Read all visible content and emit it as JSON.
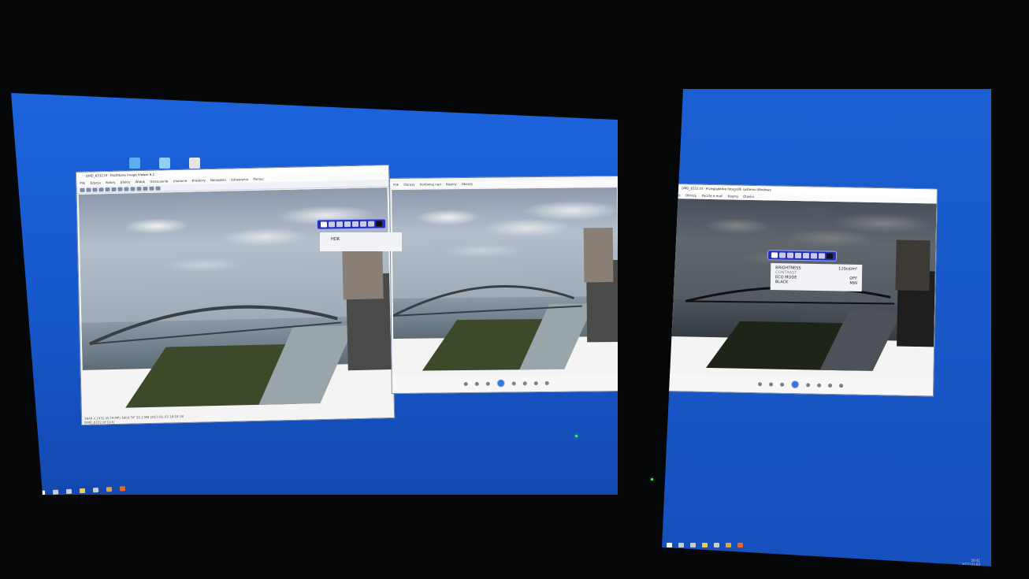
{
  "left_monitor": {
    "viewer_window": {
      "title": "DMD_8332.tif - FastStone Image Viewer 6.1",
      "menu": [
        "Plik",
        "Edycja",
        "Kolory",
        "Efekty",
        "Widok",
        "Oznaczanie",
        "Ulubione",
        "Kreatory",
        "Narzędzia",
        "Ustawienia",
        "Pomoc"
      ],
      "status_line": "3648 x 2432 (8.79 MP)  16bit  TIF  32.2 MB  2017-01-03 18:18:18",
      "status_file": "DMD_8332.tif [1/1]"
    },
    "photos_window": {
      "menu": [
        "Plik",
        "Obrazy",
        "Porównaj nad",
        "Napisy",
        "Obrazy"
      ]
    },
    "osd": {
      "mode_label": "HDR"
    }
  },
  "right_monitor": {
    "photos_window": {
      "title": "DMD_8332.tif - Przeglądarka fotografii systemu Windows",
      "menu": [
        "Plik",
        "Obrazy",
        "Pocztę e-mail",
        "Nagraj",
        "Otwórz"
      ]
    },
    "osd": {
      "rows": [
        {
          "label": "BRIGHTNESS",
          "value": "120cd/m²"
        },
        {
          "label": "CONTRAST",
          "value": ""
        },
        {
          "label": "ECO MODE",
          "value": "OFF"
        },
        {
          "label": "BLACK",
          "value": "MIN"
        }
      ]
    },
    "clock": {
      "time": "20:41",
      "date": "2017-01-03"
    }
  },
  "colors": {
    "desktop_blue": "#1a5fd6",
    "osd_blue": "#2430b8",
    "ambient": "#050608"
  }
}
